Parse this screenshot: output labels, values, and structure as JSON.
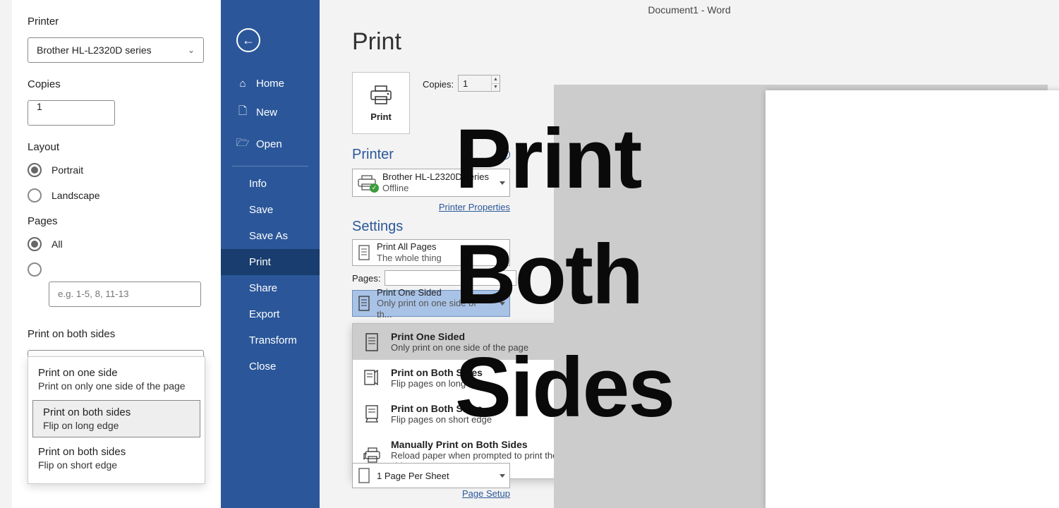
{
  "doc_title": "Document1 - Word",
  "left": {
    "printer_label": "Printer",
    "printer_value": "Brother HL-L2320D series",
    "copies_label": "Copies",
    "copies_value": "1",
    "layout_label": "Layout",
    "portrait": "Portrait",
    "landscape": "Landscape",
    "pages_label": "Pages",
    "all": "All",
    "pages_placeholder": "e.g. 1-5, 8, 11-13",
    "both_sides_label": "Print on both sides",
    "both_sides_value": "Print on both sides",
    "dd": {
      "one_t": "Print on one side",
      "one_s": "Print on only one side of the page",
      "long_t": "Print on both sides",
      "long_s": "Flip on long edge",
      "short_t": "Print on both sides",
      "short_s": "Flip on short edge"
    }
  },
  "backstage": {
    "home": "Home",
    "new": "New",
    "open": "Open",
    "info": "Info",
    "save": "Save",
    "save_as": "Save As",
    "print": "Print",
    "share": "Share",
    "export": "Export",
    "transform": "Transform",
    "close": "Close"
  },
  "main": {
    "heading": "Print",
    "print_btn": "Print",
    "copies_label": "Copies:",
    "copies_value": "1",
    "printer_section": "Printer",
    "printer_name": "Brother HL-L2320D series",
    "printer_status": "Offline",
    "printer_props": "Printer Properties",
    "settings_section": "Settings",
    "print_all_t": "Print All Pages",
    "print_all_s": "The whole thing",
    "pages_label": "Pages:",
    "one_sided_t": "Print One Sided",
    "one_sided_s": "Only print on one side of th...",
    "sheet": "1 Page Per Sheet",
    "page_setup": "Page Setup",
    "dd": {
      "opt1_t": "Print One Sided",
      "opt1_s": "Only print on one side of the page",
      "opt2_t": "Print on Both Sides",
      "opt2_s": "Flip pages on long edge",
      "opt3_t": "Print on Both Sides",
      "opt3_s": "Flip pages on short edge",
      "opt4_t": "Manually Print on Both Sides",
      "opt4_s": "Reload paper when prompted to print the second side"
    }
  },
  "preview": {
    "line1": "Print",
    "line2": "Both",
    "line3": "Sides"
  }
}
